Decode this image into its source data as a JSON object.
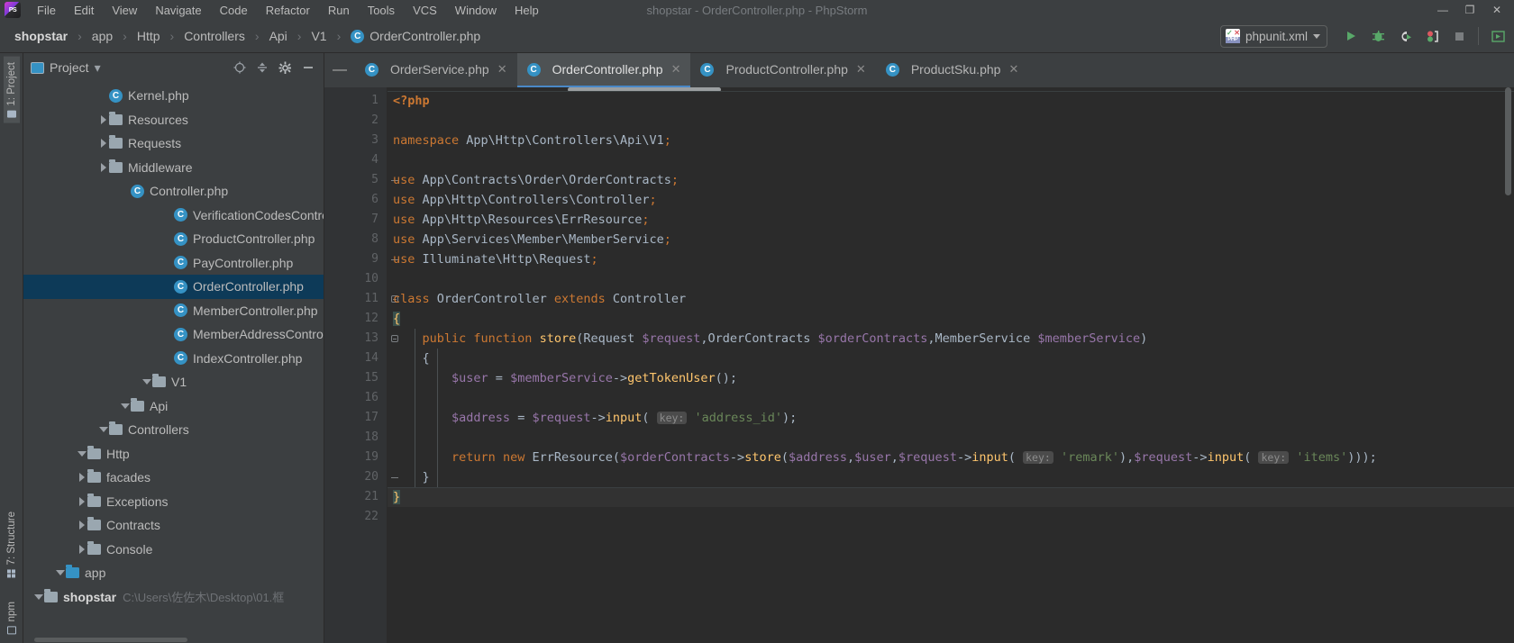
{
  "window": {
    "title": "shopstar - OrderController.php - PhpStorm",
    "minimize": "—",
    "maximize": "❐",
    "close": "✕"
  },
  "menu": {
    "items": [
      {
        "label": "File"
      },
      {
        "label": "Edit"
      },
      {
        "label": "View"
      },
      {
        "label": "Navigate"
      },
      {
        "label": "Code"
      },
      {
        "label": "Refactor"
      },
      {
        "label": "Run"
      },
      {
        "label": "Tools"
      },
      {
        "label": "VCS"
      },
      {
        "label": "Window"
      },
      {
        "label": "Help"
      }
    ]
  },
  "breadcrumb": {
    "separator": "›",
    "items": [
      {
        "label": "shopstar"
      },
      {
        "label": "app"
      },
      {
        "label": "Http"
      },
      {
        "label": "Controllers"
      },
      {
        "label": "Api"
      },
      {
        "label": "V1"
      }
    ],
    "file": {
      "label": "OrderController.php",
      "icon": "C"
    }
  },
  "toolbar": {
    "run_config": {
      "label": "phpunit.xml",
      "icon": "php-config-icon",
      "check": "✓",
      "cross": "✕",
      "php": "PHP"
    },
    "buttons": [
      {
        "name": "run-button",
        "glyph": "▶",
        "color": "#59a869"
      },
      {
        "name": "debug-button",
        "glyph": "✲",
        "color": "#59a869"
      },
      {
        "name": "run-with-coverage-button",
        "glyph": "◖",
        "color": "#d8d8d8"
      },
      {
        "name": "profile-button",
        "glyph": "⚑",
        "color": "#59a869"
      },
      {
        "name": "stop-button",
        "glyph": "■",
        "color": "#7a7d7f"
      },
      {
        "name": "more-button",
        "glyph": "▷",
        "color": "#59a869"
      }
    ]
  },
  "rail": {
    "top": [
      {
        "label": "1: Project",
        "icon": "folder-icon",
        "active": true
      }
    ],
    "bottom": [
      {
        "label": "7: Structure",
        "icon": "structure-icon",
        "active": false
      },
      {
        "label": "npm",
        "icon": "npm-icon",
        "active": false
      }
    ]
  },
  "project_panel": {
    "title": "Project",
    "caret": "▾",
    "actions": [
      {
        "name": "locate-icon",
        "glyph": "⊕"
      },
      {
        "name": "collapse-all-icon",
        "glyph": "⤓"
      },
      {
        "name": "settings-gear-icon",
        "glyph": "⚙"
      },
      {
        "name": "hide-panel-icon",
        "glyph": "—"
      }
    ],
    "tree": [
      {
        "indent": 0,
        "arrow": "down",
        "icon": "folder",
        "name": "shopstar",
        "bold": true,
        "path": "C:\\Users\\佐佐木\\Desktop\\01.框",
        "selected": false
      },
      {
        "indent": 1,
        "arrow": "down",
        "icon": "folder-blue",
        "name": "app",
        "selected": false
      },
      {
        "indent": 2,
        "arrow": "right",
        "icon": "folder",
        "name": "Console",
        "selected": false
      },
      {
        "indent": 2,
        "arrow": "right",
        "icon": "folder",
        "name": "Contracts",
        "selected": false
      },
      {
        "indent": 2,
        "arrow": "right",
        "icon": "folder",
        "name": "Exceptions",
        "selected": false
      },
      {
        "indent": 2,
        "arrow": "right",
        "icon": "folder",
        "name": "facades",
        "selected": false
      },
      {
        "indent": 2,
        "arrow": "down",
        "icon": "folder",
        "name": "Http",
        "selected": false
      },
      {
        "indent": 3,
        "arrow": "down",
        "icon": "folder",
        "name": "Controllers",
        "selected": false
      },
      {
        "indent": 4,
        "arrow": "down",
        "icon": "folder",
        "name": "Api",
        "selected": false
      },
      {
        "indent": 5,
        "arrow": "down",
        "icon": "folder",
        "name": "V1",
        "selected": false
      },
      {
        "indent": 6,
        "arrow": "none",
        "icon": "class",
        "name": "IndexController.php",
        "selected": false
      },
      {
        "indent": 6,
        "arrow": "none",
        "icon": "class",
        "name": "MemberAddressController.php",
        "selected": false
      },
      {
        "indent": 6,
        "arrow": "none",
        "icon": "class",
        "name": "MemberController.php",
        "selected": false
      },
      {
        "indent": 6,
        "arrow": "none",
        "icon": "class",
        "name": "OrderController.php",
        "selected": true
      },
      {
        "indent": 6,
        "arrow": "none",
        "icon": "class",
        "name": "PayController.php",
        "selected": false
      },
      {
        "indent": 6,
        "arrow": "none",
        "icon": "class",
        "name": "ProductController.php",
        "selected": false
      },
      {
        "indent": 6,
        "arrow": "none",
        "icon": "class",
        "name": "VerificationCodesController.php",
        "selected": false
      },
      {
        "indent": 4,
        "arrow": "none",
        "icon": "class",
        "name": "Controller.php",
        "selected": false
      },
      {
        "indent": 3,
        "arrow": "right",
        "icon": "folder",
        "name": "Middleware",
        "selected": false
      },
      {
        "indent": 3,
        "arrow": "right",
        "icon": "folder",
        "name": "Requests",
        "selected": false
      },
      {
        "indent": 3,
        "arrow": "right",
        "icon": "folder",
        "name": "Resources",
        "selected": false
      },
      {
        "indent": 3,
        "arrow": "none",
        "icon": "class",
        "name": "Kernel.php",
        "selected": false
      }
    ]
  },
  "editor": {
    "minimize_glyph": "—",
    "tabs": [
      {
        "label": "OrderService.php",
        "icon": "C",
        "active": false,
        "close": "✕"
      },
      {
        "label": "OrderController.php",
        "icon": "C",
        "active": true,
        "close": "✕"
      },
      {
        "label": "ProductController.php",
        "icon": "C",
        "active": false,
        "close": "✕"
      },
      {
        "label": "ProductSku.php",
        "icon": "C",
        "active": false,
        "close": "✕"
      }
    ],
    "line_numbers": [
      1,
      2,
      3,
      4,
      5,
      6,
      7,
      8,
      9,
      10,
      11,
      12,
      13,
      14,
      15,
      16,
      17,
      18,
      19,
      20,
      21,
      22
    ],
    "current_line": 21,
    "code_lines": [
      {
        "n": 1,
        "tokens": [
          {
            "t": "<?php",
            "c": "kw2"
          }
        ]
      },
      {
        "n": 2,
        "tokens": []
      },
      {
        "n": 3,
        "tokens": [
          {
            "t": "namespace ",
            "c": "kw"
          },
          {
            "t": "App\\Http\\Controllers\\Api\\V1",
            "c": "plain"
          },
          {
            "t": ";",
            "c": "semi"
          }
        ]
      },
      {
        "n": 4,
        "tokens": []
      },
      {
        "n": 5,
        "tokens": [
          {
            "t": "use ",
            "c": "kw"
          },
          {
            "t": "App\\Contracts\\Order\\OrderContracts",
            "c": "plain"
          },
          {
            "t": ";",
            "c": "semi"
          }
        ]
      },
      {
        "n": 6,
        "tokens": [
          {
            "t": "use ",
            "c": "kw"
          },
          {
            "t": "App\\Http\\Controllers\\Controller",
            "c": "plain"
          },
          {
            "t": ";",
            "c": "semi"
          }
        ]
      },
      {
        "n": 7,
        "tokens": [
          {
            "t": "use ",
            "c": "kw"
          },
          {
            "t": "App\\Http\\Resources\\ErrResource",
            "c": "plain"
          },
          {
            "t": ";",
            "c": "semi"
          }
        ]
      },
      {
        "n": 8,
        "tokens": [
          {
            "t": "use ",
            "c": "kw"
          },
          {
            "t": "App\\Services\\Member\\MemberService",
            "c": "plain"
          },
          {
            "t": ";",
            "c": "semi"
          }
        ]
      },
      {
        "n": 9,
        "tokens": [
          {
            "t": "use ",
            "c": "kw"
          },
          {
            "t": "Illuminate\\Http\\Request",
            "c": "plain"
          },
          {
            "t": ";",
            "c": "semi"
          }
        ]
      },
      {
        "n": 10,
        "tokens": []
      },
      {
        "n": 11,
        "tokens": [
          {
            "t": "class ",
            "c": "kw"
          },
          {
            "t": "OrderController ",
            "c": "plain"
          },
          {
            "t": "extends ",
            "c": "kw"
          },
          {
            "t": "Controller",
            "c": "plain"
          }
        ]
      },
      {
        "n": 12,
        "tokens": [
          {
            "t": "{",
            "c": "brace-hl"
          }
        ]
      },
      {
        "n": 13,
        "tokens": [
          {
            "t": "    ",
            "c": "plain"
          },
          {
            "t": "public function ",
            "c": "kw"
          },
          {
            "t": "store",
            "c": "fn"
          },
          {
            "t": "(",
            "c": "plain"
          },
          {
            "t": "Request ",
            "c": "plain"
          },
          {
            "t": "$request",
            "c": "var"
          },
          {
            "t": ",",
            "c": "plain"
          },
          {
            "t": "OrderContracts ",
            "c": "plain"
          },
          {
            "t": "$orderContracts",
            "c": "var"
          },
          {
            "t": ",",
            "c": "plain"
          },
          {
            "t": "MemberService ",
            "c": "plain"
          },
          {
            "t": "$memberService",
            "c": "var"
          },
          {
            "t": ")",
            "c": "plain"
          }
        ]
      },
      {
        "n": 14,
        "tokens": [
          {
            "t": "    {",
            "c": "plain"
          }
        ]
      },
      {
        "n": 15,
        "tokens": [
          {
            "t": "        ",
            "c": "plain"
          },
          {
            "t": "$user",
            "c": "var"
          },
          {
            "t": " = ",
            "c": "plain"
          },
          {
            "t": "$memberService",
            "c": "var"
          },
          {
            "t": "->",
            "c": "plain"
          },
          {
            "t": "getTokenUser",
            "c": "fn"
          },
          {
            "t": "();",
            "c": "plain"
          }
        ]
      },
      {
        "n": 16,
        "tokens": []
      },
      {
        "n": 17,
        "tokens": [
          {
            "t": "        ",
            "c": "plain"
          },
          {
            "t": "$address",
            "c": "var"
          },
          {
            "t": " = ",
            "c": "plain"
          },
          {
            "t": "$request",
            "c": "var"
          },
          {
            "t": "->",
            "c": "plain"
          },
          {
            "t": "input",
            "c": "fn"
          },
          {
            "t": "( ",
            "c": "plain"
          },
          {
            "t": "key:",
            "c": "hint"
          },
          {
            "t": " ",
            "c": "plain"
          },
          {
            "t": "'address_id'",
            "c": "str"
          },
          {
            "t": ");",
            "c": "plain"
          }
        ]
      },
      {
        "n": 18,
        "tokens": []
      },
      {
        "n": 19,
        "tokens": [
          {
            "t": "        ",
            "c": "plain"
          },
          {
            "t": "return ",
            "c": "kw"
          },
          {
            "t": "new ",
            "c": "kw"
          },
          {
            "t": "ErrResource",
            "c": "plain"
          },
          {
            "t": "(",
            "c": "plain"
          },
          {
            "t": "$orderContracts",
            "c": "var"
          },
          {
            "t": "->",
            "c": "plain"
          },
          {
            "t": "store",
            "c": "fn"
          },
          {
            "t": "(",
            "c": "plain"
          },
          {
            "t": "$address",
            "c": "var"
          },
          {
            "t": ",",
            "c": "plain"
          },
          {
            "t": "$user",
            "c": "var"
          },
          {
            "t": ",",
            "c": "plain"
          },
          {
            "t": "$request",
            "c": "var"
          },
          {
            "t": "->",
            "c": "plain"
          },
          {
            "t": "input",
            "c": "fn"
          },
          {
            "t": "( ",
            "c": "plain"
          },
          {
            "t": "key:",
            "c": "hint"
          },
          {
            "t": " ",
            "c": "plain"
          },
          {
            "t": "'remark'",
            "c": "str"
          },
          {
            "t": "),",
            "c": "plain"
          },
          {
            "t": "$request",
            "c": "var"
          },
          {
            "t": "->",
            "c": "plain"
          },
          {
            "t": "input",
            "c": "fn"
          },
          {
            "t": "( ",
            "c": "plain"
          },
          {
            "t": "key:",
            "c": "hint"
          },
          {
            "t": " ",
            "c": "plain"
          },
          {
            "t": "'items'",
            "c": "str"
          },
          {
            "t": ")));",
            "c": "plain"
          }
        ]
      },
      {
        "n": 20,
        "tokens": [
          {
            "t": "    }",
            "c": "plain"
          }
        ]
      },
      {
        "n": 21,
        "tokens": [
          {
            "t": "}",
            "c": "brace-hl"
          }
        ]
      },
      {
        "n": 22,
        "tokens": []
      }
    ]
  },
  "colors": {
    "accent": "#3592c4",
    "selection": "#0d3a58",
    "editor_bg": "#2b2b2b",
    "panel_bg": "#3c3f41",
    "keyword": "#cc7832",
    "string": "#6a8759",
    "variable": "#9876aa",
    "function": "#ffc66d",
    "run_green": "#59a869"
  }
}
